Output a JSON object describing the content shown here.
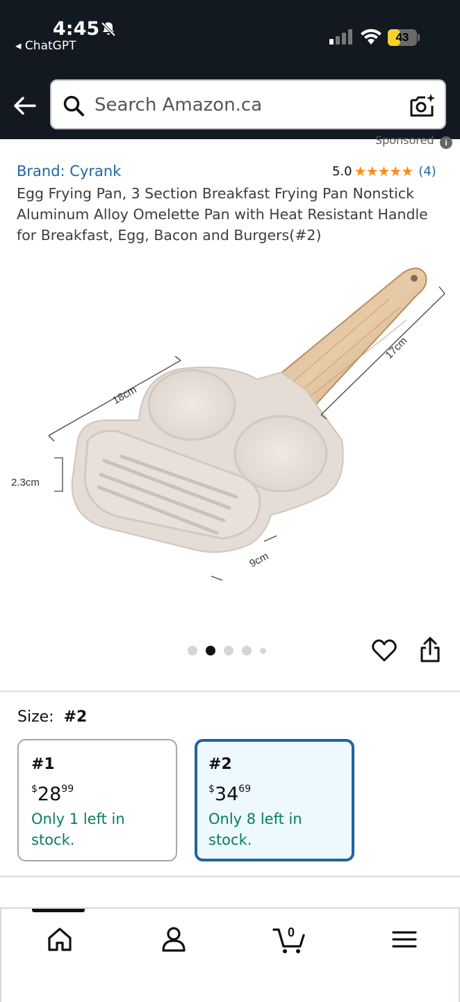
{
  "status_bar": {
    "time": "4:45",
    "back_app": "◂ ChatGPT",
    "battery": "43",
    "battery_fraction": 0.43
  },
  "search": {
    "placeholder": "Search Amazon.ca"
  },
  "product": {
    "sponsored": "Sponsored",
    "brand": "Brand: Cyrank",
    "rating_value": "5.0",
    "stars": "★★★★★",
    "rating_count": "(4)",
    "title": "Egg Frying Pan, 3 Section Breakfast Frying Pan Nonstick Aluminum Alloy Omelette Pan with Heat Resistant Handle for Breakfast, Egg, Bacon and Burgers(#2)",
    "image": {
      "dim_18": "18cm",
      "dim_17": "17cm",
      "dim_23": "2.3cm",
      "dim_9": "9cm"
    },
    "carousel": {
      "count": 5,
      "active_index": 1
    }
  },
  "size_selector": {
    "label": "Size:",
    "selected": "#2",
    "options": [
      {
        "name": "#1",
        "currency": "$",
        "price_whole": "28",
        "price_fraction": "99",
        "stock": "Only 1 left in stock."
      },
      {
        "name": "#2",
        "currency": "$",
        "price_whole": "34",
        "price_fraction": "69",
        "stock": "Only 8 left in stock."
      }
    ]
  },
  "bottom_nav": {
    "cart_count": "0",
    "items": [
      "home-icon",
      "account-icon",
      "cart-icon",
      "menu-icon"
    ]
  },
  "icons": [
    "bell-muted-icon",
    "signal-icon",
    "wifi-icon",
    "back-arrow-icon",
    "search-icon",
    "camera-search-icon",
    "info-icon",
    "heart-icon",
    "share-icon"
  ],
  "colors": {
    "header_bg": "#131921",
    "link": "#1f65a6",
    "star": "#ff8c14",
    "stock_green": "#067d62",
    "selected_border": "#2162a1",
    "selected_bg": "#edf8ff"
  }
}
